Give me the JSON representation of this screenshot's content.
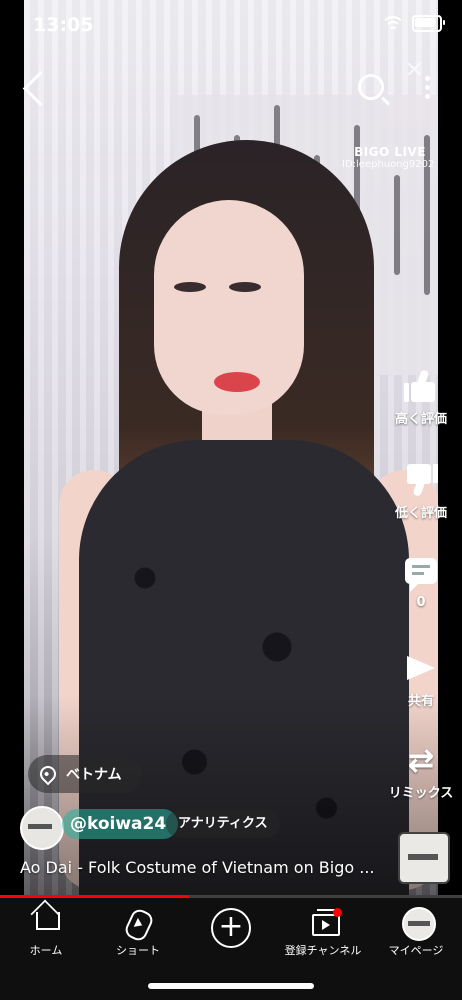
{
  "status_bar": {
    "time": "13:05"
  },
  "watermark": {
    "brand": "BIGO LIVE",
    "id": "ID:leephuong9202"
  },
  "actions": {
    "like_label": "高く評価",
    "dislike_label": "低く評価",
    "comment_count": "0",
    "share_label": "共有",
    "remix_label": "リミックス"
  },
  "location": {
    "label": "ベトナム"
  },
  "channel": {
    "handle": "@koiwa24",
    "analytics_label": "アナリティクス"
  },
  "video": {
    "title": "Ao Dai - Folk Costume of Vietnam on Bigo ...",
    "progress": 0.41
  },
  "nav": {
    "home": "ホーム",
    "shorts": "ショート",
    "subscriptions": "登録チャンネル",
    "mypage": "マイページ"
  },
  "colors": {
    "accent": "#ff0000",
    "nav_bg": "#0f0f0f"
  }
}
